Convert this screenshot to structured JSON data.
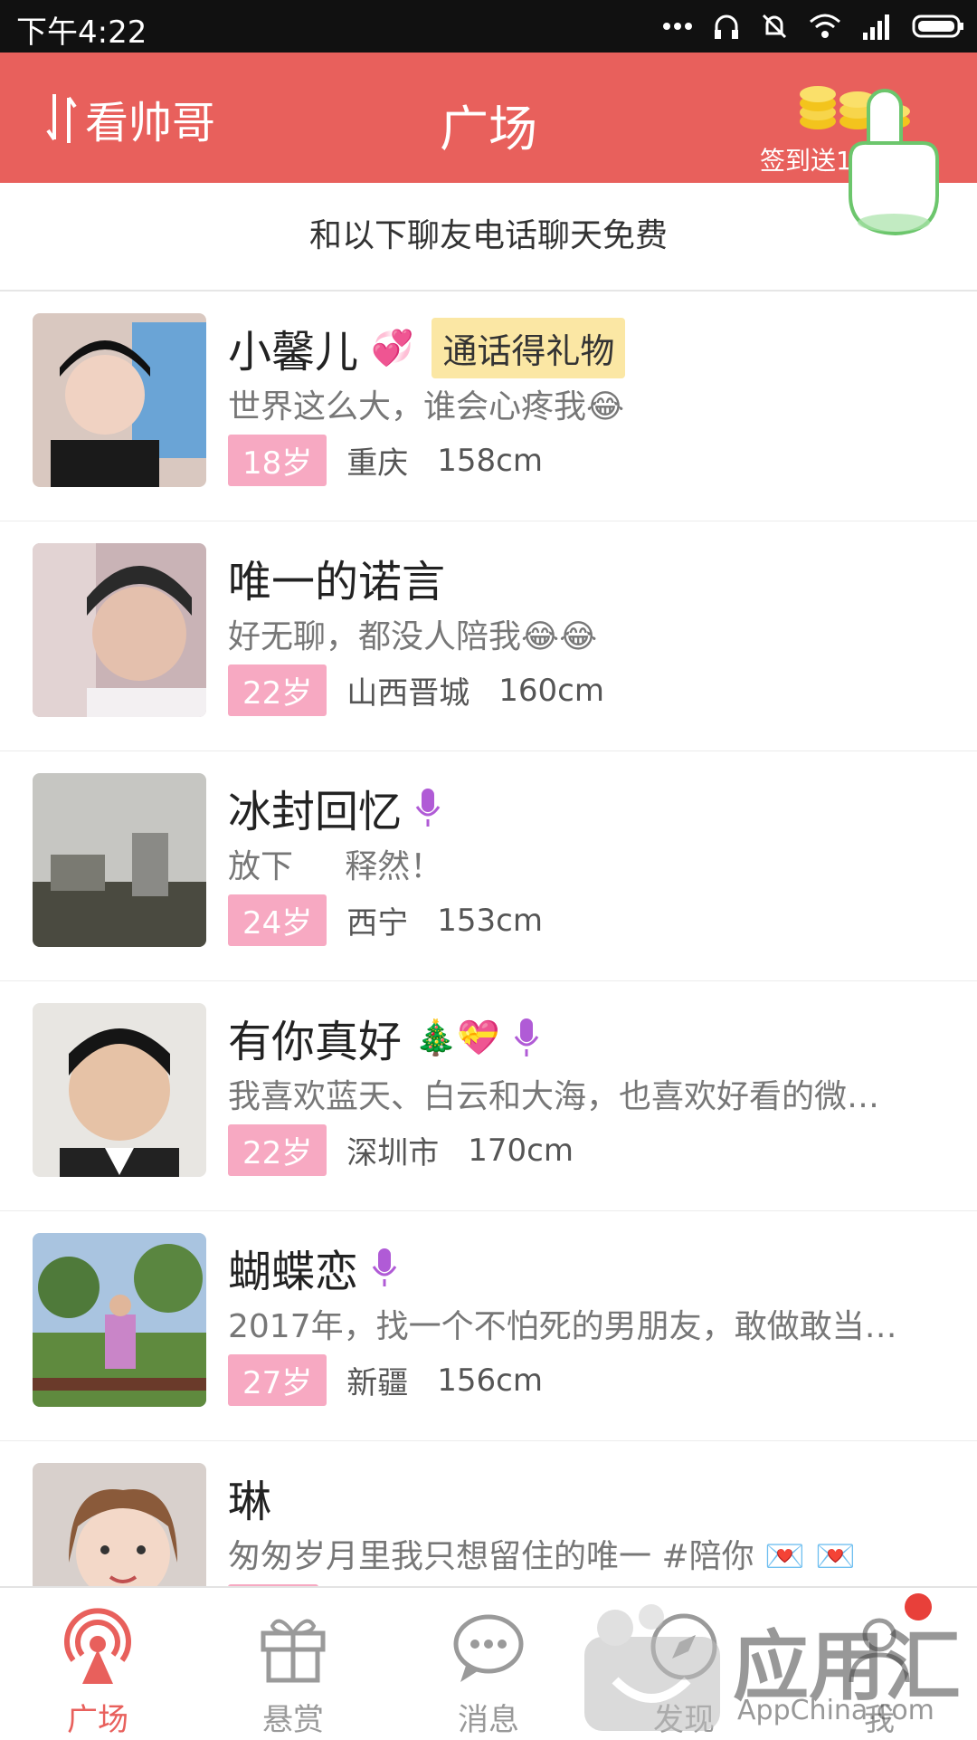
{
  "status_bar": {
    "time": "下午4:22"
  },
  "header": {
    "switch_label": "看帅哥",
    "title": "广场",
    "checkin_label": "签到送1-"
  },
  "notice": "和以下聊友电话聊天免费",
  "list": [
    {
      "name": "小馨儿",
      "emoji": "💞",
      "tag": "通话得礼物",
      "signature": "世界这么大，谁会心疼我😂",
      "age": "18岁",
      "location": "重庆",
      "height": "158cm",
      "voice": false
    },
    {
      "name": "唯一的诺言",
      "emoji": "",
      "tag": "",
      "signature": "好无聊，都没人陪我😂😂",
      "age": "22岁",
      "location": "山西晋城",
      "height": "160cm",
      "voice": false
    },
    {
      "name": "冰封回忆",
      "emoji": "",
      "tag": "",
      "signature": "放下     释然！",
      "age": "24岁",
      "location": "西宁",
      "height": "153cm",
      "voice": true
    },
    {
      "name": "有你真好",
      "emoji": "🎄💝",
      "tag": "",
      "signature": "我喜欢蓝天、白云和大海，也喜欢好看的微…",
      "age": "22岁",
      "location": "深圳市",
      "height": "170cm",
      "voice": true
    },
    {
      "name": "蝴蝶恋",
      "emoji": "",
      "tag": "",
      "signature": "2017年，找一个不怕死的男朋友，敢做敢当…",
      "age": "27岁",
      "location": "新疆",
      "height": "156cm",
      "voice": true
    },
    {
      "name": "琳",
      "emoji": "",
      "tag": "",
      "signature": "匆匆岁月里我只想留住的唯一 #陪你 💌 💌",
      "age": "",
      "location": "",
      "height": "",
      "voice": false
    }
  ],
  "bottom_nav": {
    "tabs": [
      {
        "label": "广场",
        "icon": "broadcast-icon",
        "active": true
      },
      {
        "label": "悬赏",
        "icon": "gift-icon",
        "active": false
      },
      {
        "label": "消息",
        "icon": "chat-bubble-icon",
        "active": false
      },
      {
        "label": "发现",
        "icon": "compass-icon",
        "active": false
      },
      {
        "label": "我",
        "icon": "person-icon",
        "active": false
      }
    ]
  },
  "watermark": {
    "cn": "应用汇",
    "en": "AppChina.com"
  },
  "colors": {
    "header": "#e8605c",
    "age_badge": "#f7a9c2",
    "tag_bg": "#fbe7a4",
    "mic": "#b05bd6"
  }
}
